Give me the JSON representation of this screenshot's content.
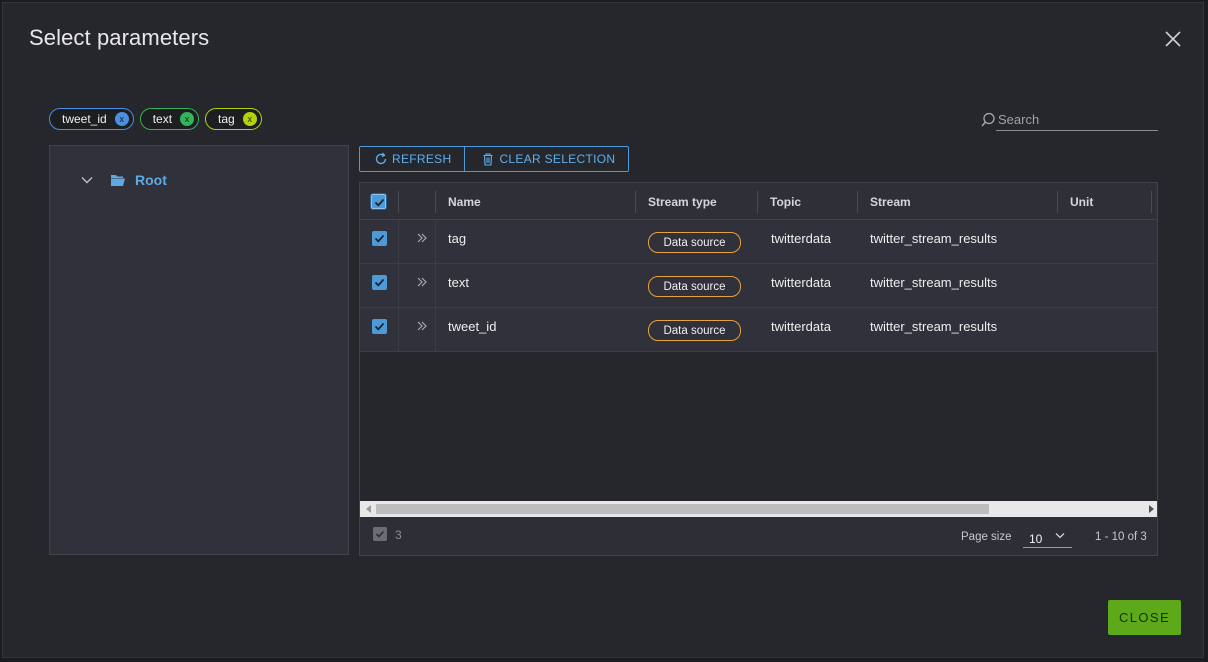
{
  "dialog": {
    "title": "Select parameters",
    "close_label": "CLOSE"
  },
  "chips": [
    {
      "label": "tweet_id",
      "remove": "x",
      "color": "#4a8fe0"
    },
    {
      "label": "text",
      "remove": "x",
      "color": "#34b45a"
    },
    {
      "label": "tag",
      "remove": "x",
      "color": "#b3d20e"
    }
  ],
  "search": {
    "placeholder": "Search",
    "value": ""
  },
  "tree": {
    "root_label": "Root"
  },
  "toolbar": {
    "refresh_label": "REFRESH",
    "clear_label": "CLEAR SELECTION"
  },
  "grid": {
    "columns": {
      "name": "Name",
      "stream_type": "Stream type",
      "topic": "Topic",
      "stream": "Stream",
      "unit": "Unit"
    },
    "rows": [
      {
        "name": "tag",
        "stream_type": "Data source",
        "topic": "twitterdata",
        "stream": "twitter_stream_results",
        "unit": "",
        "checked": true
      },
      {
        "name": "text",
        "stream_type": "Data source",
        "topic": "twitterdata",
        "stream": "twitter_stream_results",
        "unit": "",
        "checked": true
      },
      {
        "name": "tweet_id",
        "stream_type": "Data source",
        "topic": "twitterdata",
        "stream": "twitter_stream_results",
        "unit": "",
        "checked": true
      }
    ],
    "footer": {
      "selected_count": "3",
      "page_size_label": "Page size",
      "page_size_value": "10",
      "range_text": "1 - 10 of 3"
    }
  },
  "colors": {
    "accent": "#4e9ad6",
    "badge_border": "#e6a03c",
    "close_button": "#5da919"
  }
}
